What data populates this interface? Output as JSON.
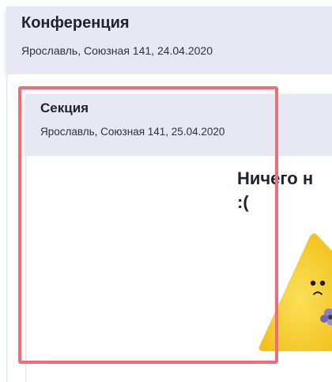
{
  "conference": {
    "title": "Конференция",
    "meta": "Ярославль, Союзная 141, 24.04.2020"
  },
  "section": {
    "title": "Секция",
    "meta": "Ярославль, Союзная 141, 25.04.2020"
  },
  "empty_state": {
    "message": "Ничего н\n:(",
    "illustration": "sad-triangle-mascot-icon"
  },
  "colors": {
    "card_background": "#e6e9f4",
    "highlight_border": "#ee6d7a",
    "mascot_yellow": "#f7d23a"
  }
}
